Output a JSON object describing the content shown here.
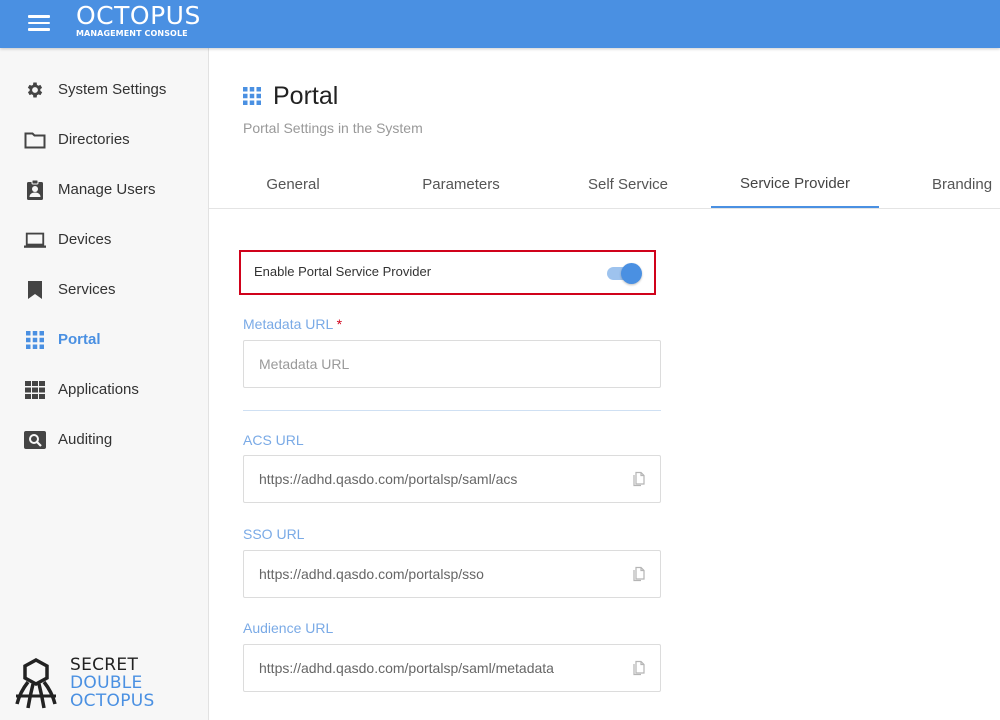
{
  "header": {
    "brand_name": "OCTOPUS",
    "brand_sub": "MANAGEMENT CONSOLE"
  },
  "sidebar": {
    "items": [
      {
        "label": "System Settings",
        "icon": "gear-icon"
      },
      {
        "label": "Directories",
        "icon": "folder-icon"
      },
      {
        "label": "Manage Users",
        "icon": "user-badge-icon"
      },
      {
        "label": "Devices",
        "icon": "laptop-icon"
      },
      {
        "label": "Services",
        "icon": "bookmark-icon"
      },
      {
        "label": "Portal",
        "icon": "grid-icon",
        "active": true
      },
      {
        "label": "Applications",
        "icon": "apps-icon"
      },
      {
        "label": "Auditing",
        "icon": "search-box-icon"
      }
    ],
    "logo": {
      "line1": "SECRET",
      "line2": "DOUBLE",
      "line3": "OCTOPUS"
    }
  },
  "page": {
    "title": "Portal",
    "subtitle": "Portal Settings in the System"
  },
  "tabs": [
    {
      "label": "General"
    },
    {
      "label": "Parameters"
    },
    {
      "label": "Self Service"
    },
    {
      "label": "Service Provider",
      "active": true
    },
    {
      "label": "Branding"
    }
  ],
  "form": {
    "enable_label": "Enable Portal Service Provider",
    "enable_value": true,
    "metadata_label": "Metadata URL",
    "metadata_required": "*",
    "metadata_placeholder": "Metadata URL",
    "acs_label": "ACS URL",
    "acs_value": "https://adhd.qasdo.com/portalsp/saml/acs",
    "sso_label": "SSO URL",
    "sso_value": "https://adhd.qasdo.com/portalsp/sso",
    "audience_label": "Audience URL",
    "audience_value": "https://adhd.qasdo.com/portalsp/saml/metadata"
  },
  "colors": {
    "primary": "#4a90e2",
    "highlight_border": "#d0021b",
    "sidebar_bg": "#f7f7f7"
  }
}
